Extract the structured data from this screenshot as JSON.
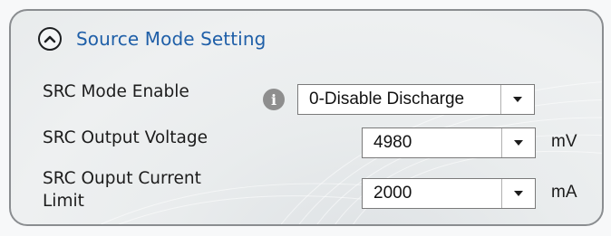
{
  "section": {
    "title": "Source Mode Setting"
  },
  "rows": [
    {
      "label": "SRC Mode Enable",
      "value": "0-Disable Discharge",
      "unit": ""
    },
    {
      "label": "SRC Output Voltage",
      "value": "4980",
      "unit": "mV"
    },
    {
      "label_line1": "SRC Ouput Current",
      "label_line2": "Limit",
      "value": "2000",
      "unit": "mA"
    }
  ],
  "icons": {
    "collapse": "chevron-up-icon",
    "info": "info-icon",
    "dropdown": "caret-down-icon"
  },
  "colors": {
    "header_text": "#1f5fa8",
    "info_icon": "#8e8e8e",
    "border": "#8a8d90"
  }
}
